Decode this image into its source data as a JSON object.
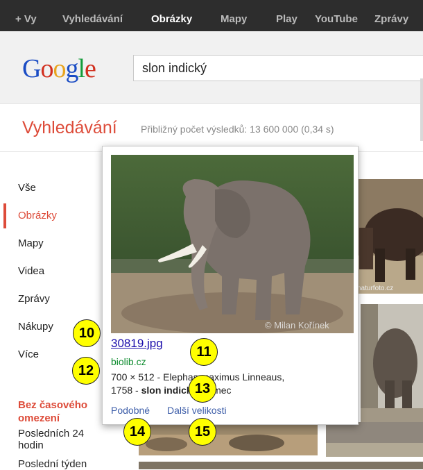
{
  "topbar": {
    "items": [
      {
        "label": "+ Vy"
      },
      {
        "label": "Vyhledávání"
      },
      {
        "label": "Obrázky",
        "active": true
      },
      {
        "label": "Mapy"
      },
      {
        "label": "Play"
      },
      {
        "label": "YouTube"
      },
      {
        "label": "Zprávy"
      }
    ]
  },
  "logo": {
    "letters": [
      "G",
      "o",
      "o",
      "g",
      "l",
      "e"
    ]
  },
  "search": {
    "value": "slon indický"
  },
  "results_header": {
    "title": "Vyhledávání",
    "stats": "Přibližný počet výsledků: 13 600 000 (0,34 s)"
  },
  "sidebar": {
    "items": [
      {
        "label": "Vše"
      },
      {
        "label": "Obrázky",
        "active": true
      },
      {
        "label": "Mapy"
      },
      {
        "label": "Videa"
      },
      {
        "label": "Zprávy"
      },
      {
        "label": "Nákupy"
      },
      {
        "label": "Více"
      }
    ],
    "time_filter": {
      "heading": "Bez časového omezení",
      "options": [
        "Posledních 24 hodin",
        "Poslední týden"
      ]
    }
  },
  "popup": {
    "watermark": "© Milan Kořínek",
    "filename": "30819.jpg",
    "domain": "biolib.cz",
    "desc_line1": "700 × 512 - Elephas maximus Linneaus,",
    "desc_pre": "1758 - ",
    "desc_bold": "slon indický",
    "desc_post": ", samec",
    "similar_label": "Podobné",
    "sizes_label": "Další velikosti"
  },
  "thumbs": {
    "watermark": "naturfoto.cz"
  },
  "badges": [
    "10",
    "11",
    "12",
    "13",
    "14",
    "15"
  ],
  "colors": {
    "topbar_bg": "#2d2d2d",
    "accent_red": "#dd4b39",
    "link_blue": "#1a0dab",
    "domain_green": "#0b8a2c",
    "badge_yellow": "#ffff00"
  }
}
